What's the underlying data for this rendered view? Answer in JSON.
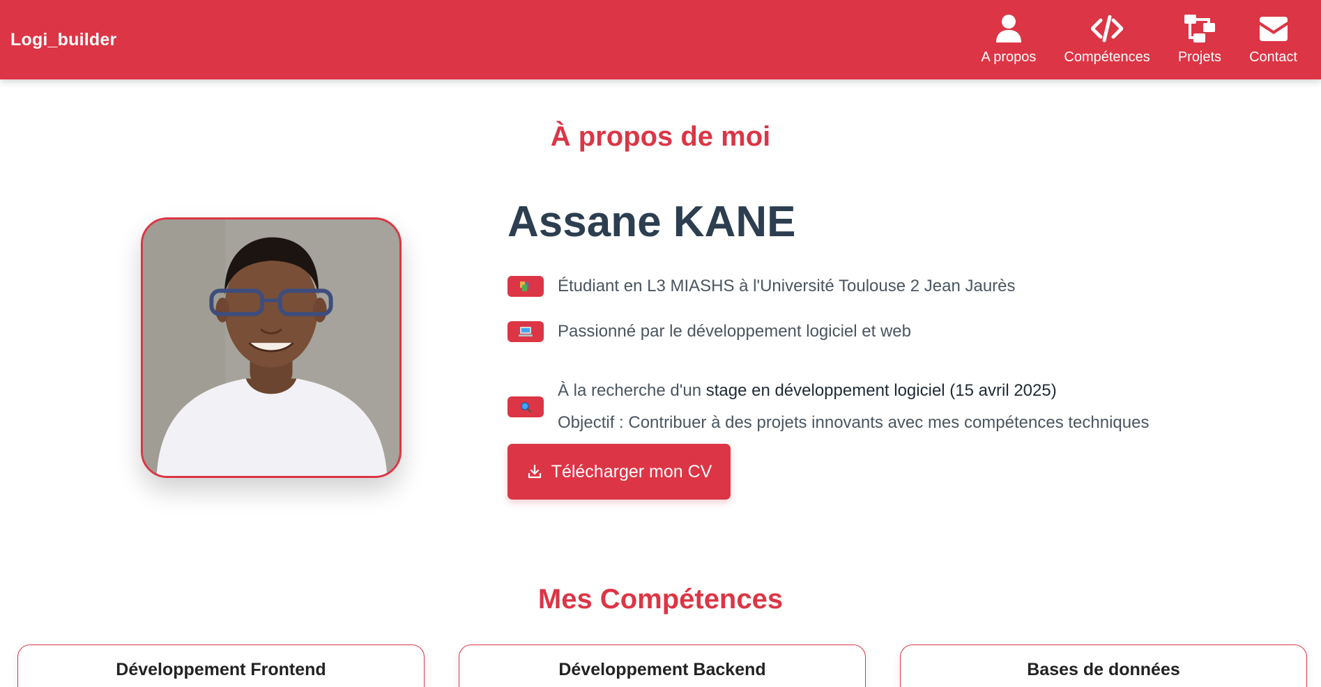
{
  "header": {
    "brand": "Logi_builder",
    "nav": [
      {
        "label": "A propos",
        "icon": "user-icon"
      },
      {
        "label": "Compétences",
        "icon": "code-icon"
      },
      {
        "label": "Projets",
        "icon": "sitemap-icon"
      },
      {
        "label": "Contact",
        "icon": "envelope-icon"
      }
    ]
  },
  "about": {
    "title": "À propos de moi",
    "name": "Assane KANE",
    "rows": [
      {
        "icon": "books-icon",
        "text": "Étudiant en L3 MIASHS à l'Université Toulouse 2 Jean Jaurès"
      },
      {
        "icon": "laptop-icon",
        "text": "Passionné par le développement logiciel et web"
      },
      {
        "icon": "magnifier-icon",
        "prefix": "À la recherche d'un ",
        "highlight": "stage en développement logiciel (15 avril 2025)",
        "line2": "Objectif : Contribuer à des projets innovants avec mes compétences techniques"
      }
    ],
    "cv_button": "Télécharger mon CV"
  },
  "skills": {
    "title": "Mes Compétences",
    "cards": [
      "Développement Frontend",
      "Développement Backend",
      "Bases de données"
    ]
  },
  "colors": {
    "accent": "#dc3545",
    "name": "#2c3e50",
    "text": "#4a5560"
  }
}
